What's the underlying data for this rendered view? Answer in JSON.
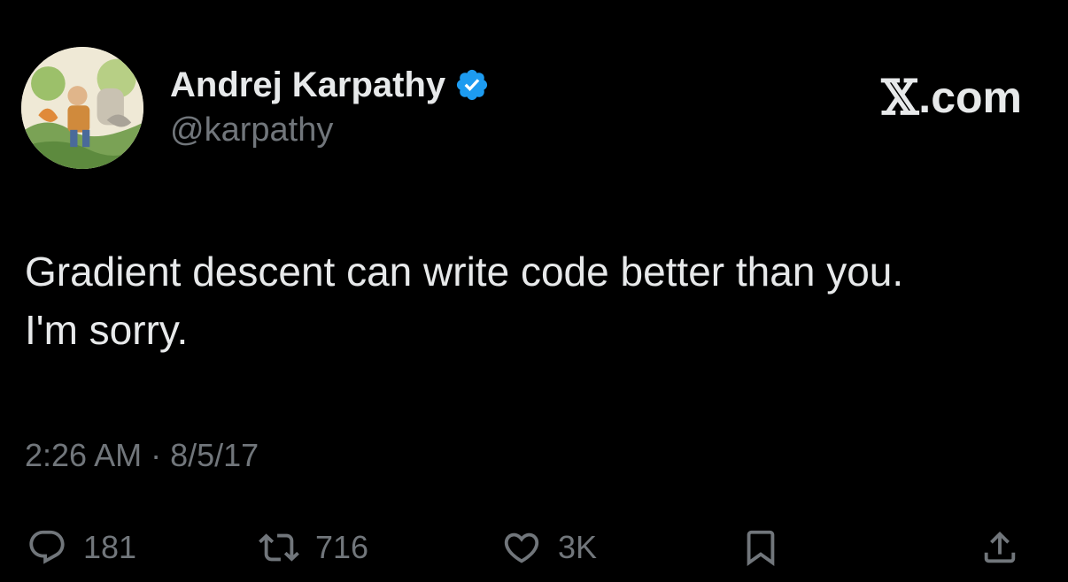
{
  "author": {
    "display_name": "Andrej Karpathy",
    "handle": "@karpathy",
    "verified": true,
    "verified_color": "#1d9bf0",
    "avatar_icon": "illustrated-avatar"
  },
  "brand": {
    "x_glyph": "𝕏",
    "suffix": ".com"
  },
  "tweet": {
    "lines": [
      "Gradient descent can write code better than you.",
      "I'm sorry."
    ]
  },
  "meta": {
    "time": "2:26 AM",
    "separator": " · ",
    "date": "8/5/17"
  },
  "actions": {
    "reply_count": "181",
    "repost_count": "716",
    "like_count": "3K",
    "icons": [
      "reply-icon",
      "repost-icon",
      "like-icon",
      "bookmark-icon",
      "share-icon"
    ]
  },
  "colors": {
    "background": "#000000",
    "primary_text": "#e7e9ea",
    "secondary_text": "#71767b"
  }
}
